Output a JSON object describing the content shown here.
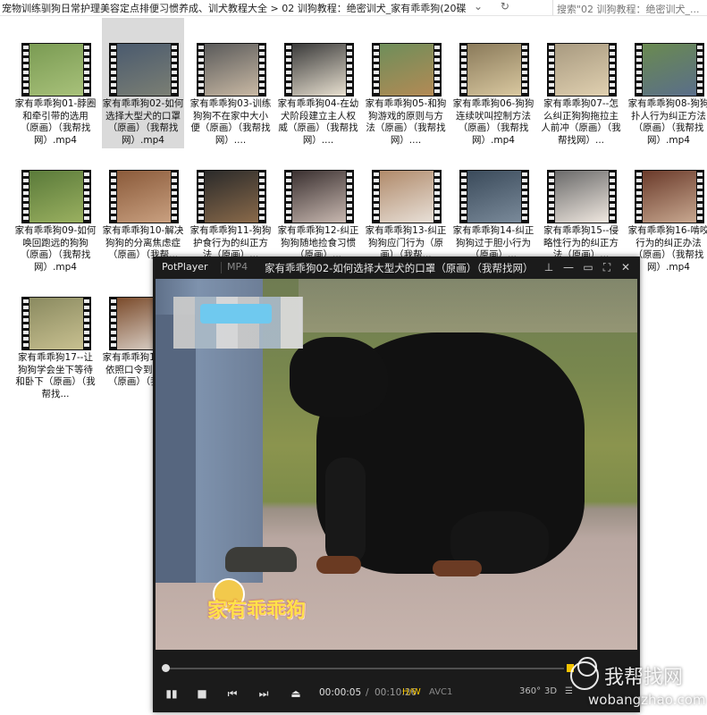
{
  "explorer": {
    "title_path": "宠物训练驯狗日常护理美容定点排便习惯养成、训犬教程大全 > 02 训狗教程：绝密训犬_家有乖乖狗(20碟)",
    "nav_icons": "⌄ ↻",
    "search_placeholder": "搜索\"02 训狗教程：绝密训犬_...",
    "files": [
      {
        "caption": "家有乖乖狗01-脖圈和牵引带的选用（原画）（我帮找网）.mp4",
        "thumb_colors": [
          "#7a9b53",
          "#a8c17a"
        ]
      },
      {
        "caption": "家有乖乖狗02-如何选择大型犬的口罩（原画）（我帮找网）.mp4",
        "thumb_colors": [
          "#4a5a6e",
          "#7b7f74"
        ],
        "selected": true
      },
      {
        "caption": "家有乖乖狗03-训练狗狗不在家中大小便（原画）（我帮找网）....",
        "thumb_colors": [
          "#5a5a5a",
          "#c9b9a4"
        ]
      },
      {
        "caption": "家有乖乖狗04-在幼犬阶段建立主人权威（原画）（我帮找网）....",
        "thumb_colors": [
          "#3a3a3a",
          "#e8e0d0"
        ]
      },
      {
        "caption": "家有乖乖狗05-和狗狗游戏的原则与方法（原画）（我帮找网）....",
        "thumb_colors": [
          "#6e8e5a",
          "#b38a55"
        ]
      },
      {
        "caption": "家有乖乖狗06-狗狗连续吠叫控制方法（原画）（我帮找网）.mp4",
        "thumb_colors": [
          "#8a7a5a",
          "#d9c8a0"
        ]
      },
      {
        "caption": "家有乖乖狗07--怎么纠正狗狗拖拉主人前冲（原画）（我帮找网）...",
        "thumb_colors": [
          "#a89a80",
          "#e0d0b0"
        ]
      },
      {
        "caption": "家有乖乖狗08-狗狗扑人行为纠正方法（原画）（我帮找网）.mp4",
        "thumb_colors": [
          "#6a8a50",
          "#5a6e8a"
        ]
      },
      {
        "caption": "家有乖乖狗09-如何唤回跑远的狗狗（原画）（我帮找网）.mp4",
        "thumb_colors": [
          "#5a7a3a",
          "#9ab060"
        ]
      },
      {
        "caption": "家有乖乖狗10-解决狗狗的分离焦虑症（原画）（我帮...",
        "thumb_colors": [
          "#8a5a3a",
          "#c9a080"
        ]
      },
      {
        "caption": "家有乖乖狗11-狗狗护食行为的纠正方法（原画）...",
        "thumb_colors": [
          "#2a2a2a",
          "#8a6a4a"
        ]
      },
      {
        "caption": "家有乖乖狗12-纠正狗狗随地捡食习惯（原画）...",
        "thumb_colors": [
          "#3a3030",
          "#c8b8b0"
        ]
      },
      {
        "caption": "家有乖乖狗13-纠正狗狗应门行为（原画）（我帮...",
        "thumb_colors": [
          "#b08a6a",
          "#e8e0d8"
        ]
      },
      {
        "caption": "家有乖乖狗14-纠正狗狗过于胆小行为（原画）...",
        "thumb_colors": [
          "#3a4a5a",
          "#7a8a9a"
        ]
      },
      {
        "caption": "家有乖乖狗15--侵略性行为的纠正方法（原画）...",
        "thumb_colors": [
          "#6a6a6a",
          "#f0e8e0"
        ]
      },
      {
        "caption": "家有乖乖狗16-啃咬行为的纠正办法（原画）（我帮找网）.mp4",
        "thumb_colors": [
          "#6a3a2a",
          "#c8a890"
        ]
      },
      {
        "caption": "家有乖乖狗17--让狗狗学会坐下等待和卧下（原画）（我帮找...",
        "thumb_colors": [
          "#8a8a60",
          "#c8c090"
        ]
      },
      {
        "caption": "家有乖乖狗18-狗狗依照口令到笼子里（原画）（我帮...",
        "thumb_colors": [
          "#7a4a2a",
          "#e0d8d0"
        ]
      }
    ]
  },
  "player": {
    "app_name": "PotPlayer",
    "format": "MP4",
    "title": "家有乖乖狗02-如何选择大型犬的口罩（原画）（我帮找网）",
    "window_buttons": {
      "pin": "⊥",
      "min": "—",
      "max": "▭",
      "full": "⛶",
      "close": "✕"
    },
    "watermark_logo": "家有乖乖狗",
    "progress": 0.005,
    "volume": 0.7,
    "controls": {
      "play": "▮▮",
      "stop": "■",
      "prev": "⏮",
      "next": "⏭",
      "eject": "⏏"
    },
    "time_current": "00:00:05",
    "time_total": "00:10:26",
    "hw": "H/W",
    "codec": "AVC1",
    "right_icons": {
      "degrees": "360°",
      "three_d": "3D",
      "menu": "☰"
    }
  },
  "site_watermark": {
    "cn": "我帮找网",
    "en": "wobangzhao.com"
  }
}
